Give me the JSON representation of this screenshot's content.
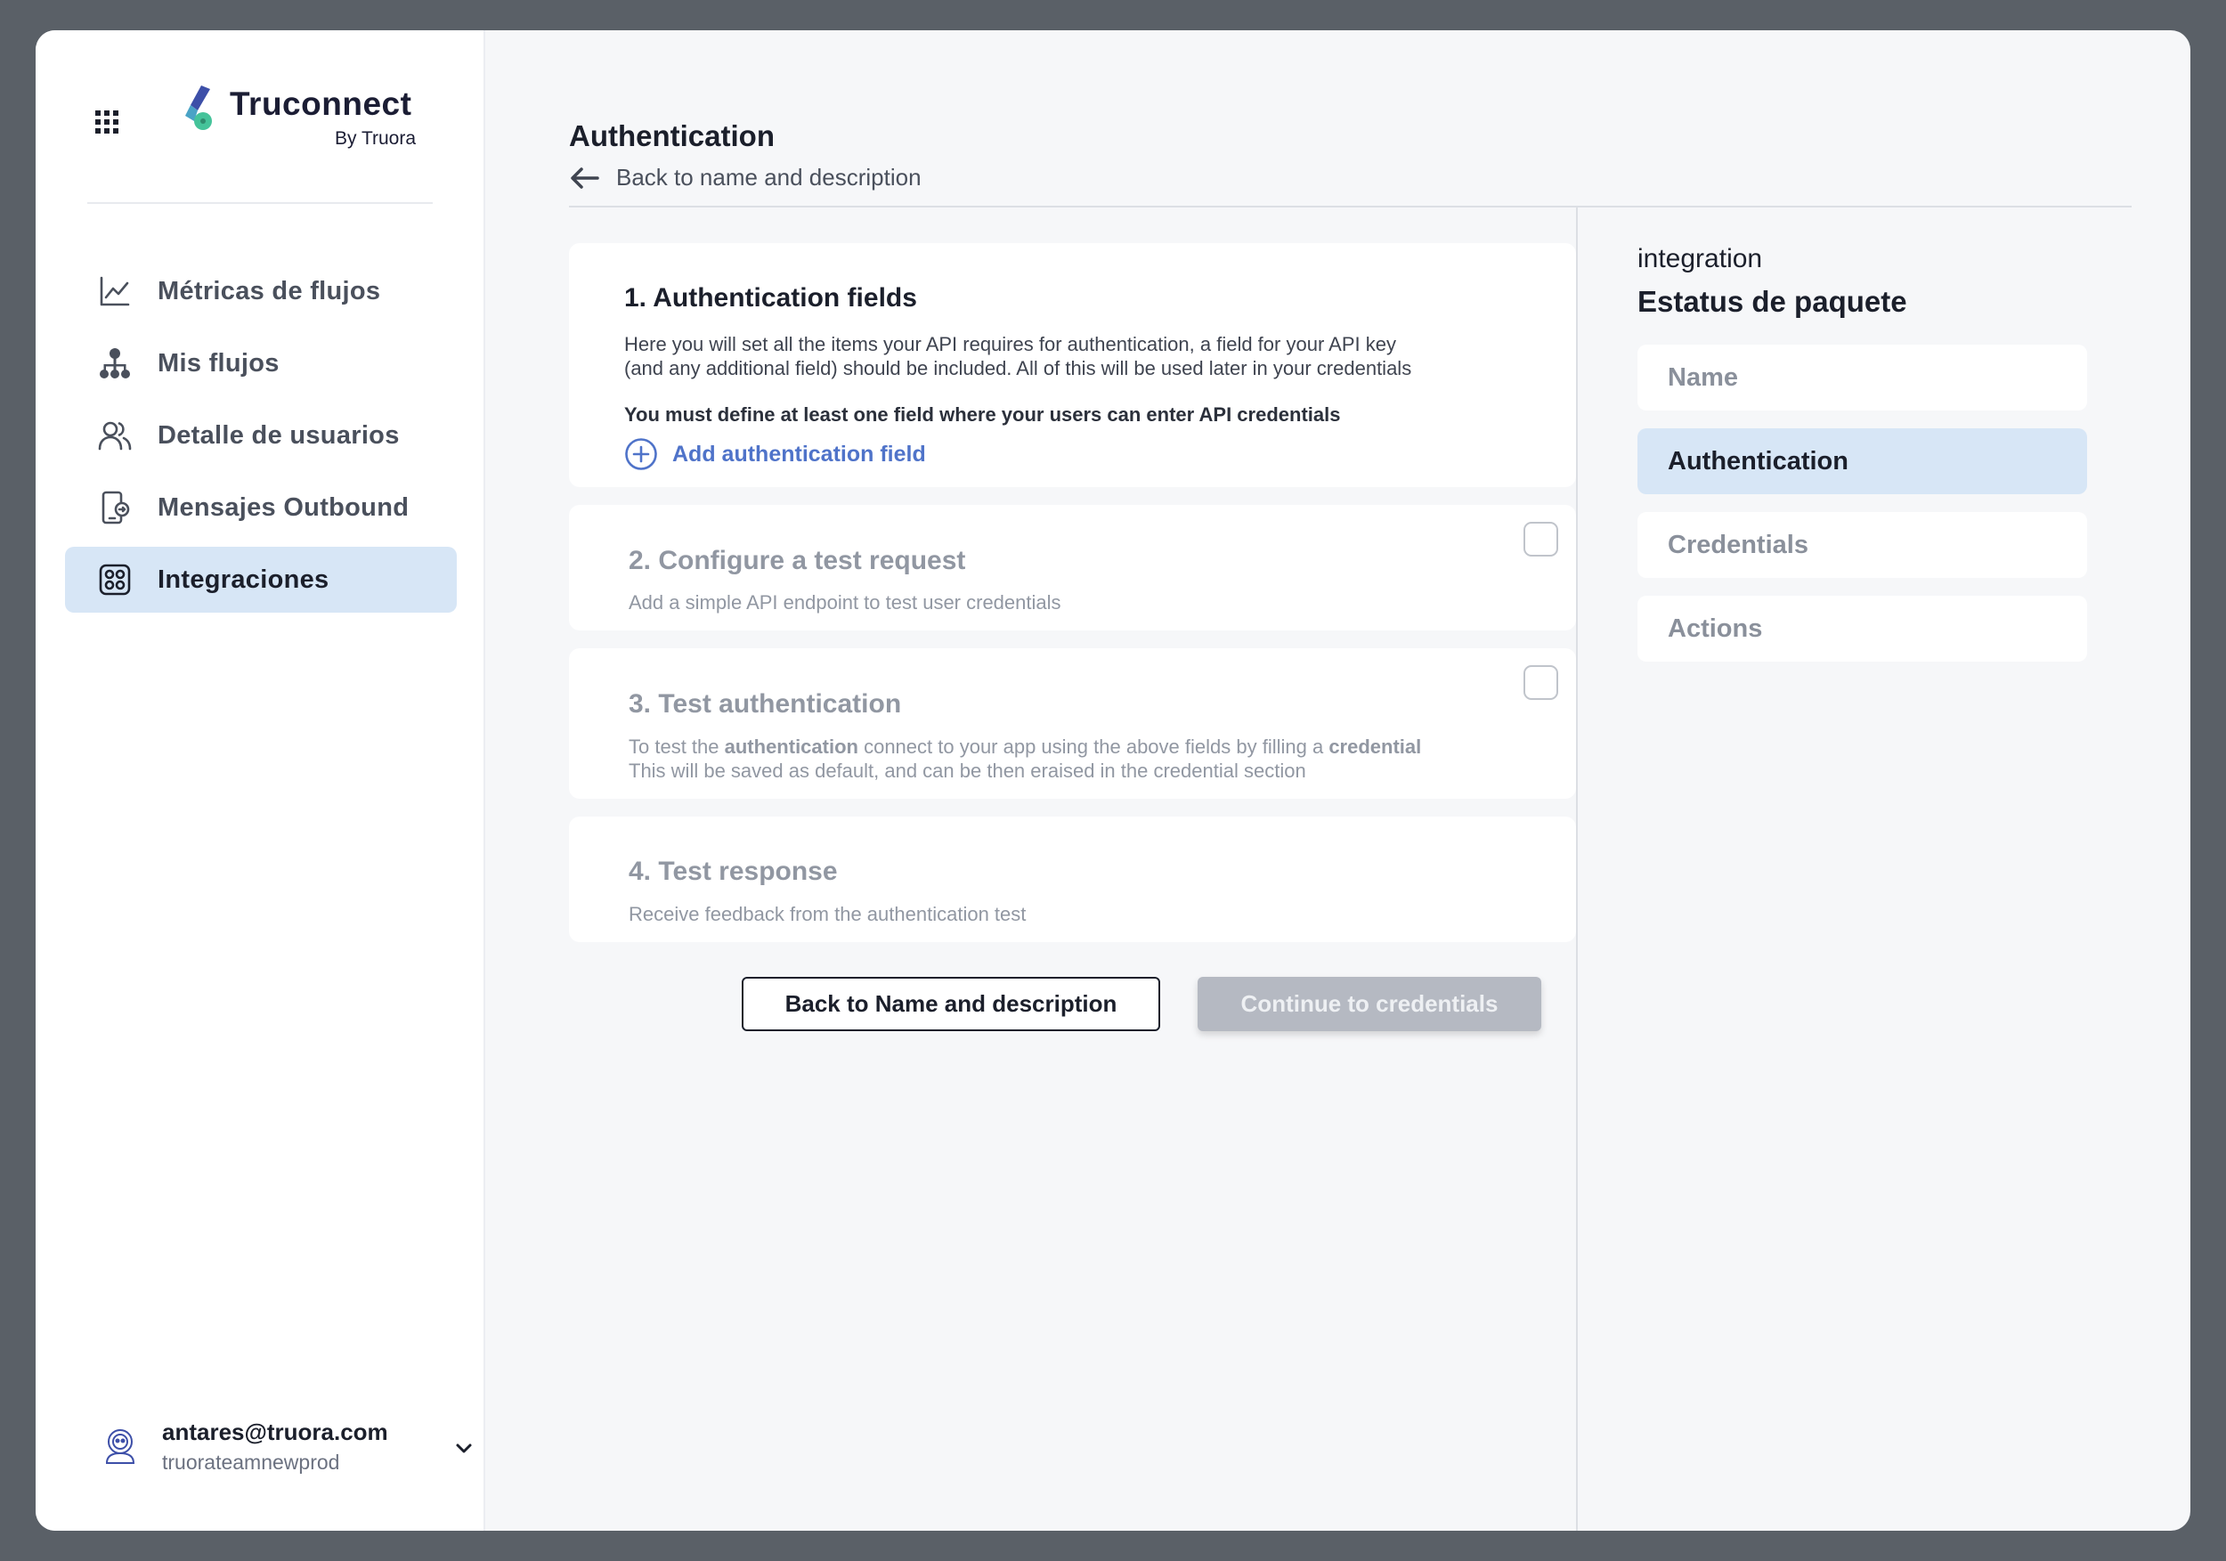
{
  "brand": {
    "name": "Truconnect",
    "sub": "By Truora"
  },
  "sidebar": {
    "items": [
      {
        "label": "Métricas de flujos",
        "icon": "chart-line-icon",
        "active": false
      },
      {
        "label": "Mis flujos",
        "icon": "flow-tree-icon",
        "active": false
      },
      {
        "label": "Detalle de usuarios",
        "icon": "users-icon",
        "active": false
      },
      {
        "label": "Mensajes Outbound",
        "icon": "outbound-message-icon",
        "active": false
      },
      {
        "label": "Integraciones",
        "icon": "integrations-icon",
        "active": true
      }
    ]
  },
  "user": {
    "email": "antares@truora.com",
    "org": "truorateamnewprod"
  },
  "main": {
    "title": "Authentication",
    "back_link": "Back to name and description",
    "cards": [
      {
        "title": "1. Authentication fields",
        "text1": "Here you will set all the items your API requires for authentication, a field for your API key",
        "text2": "(and any additional field) should be included. All of this will be used later in your credentials",
        "warning": "You must define at least one field where your users can enter API credentials",
        "add_label": "Add authentication field"
      },
      {
        "title": "2. Configure a test request",
        "text1": "Add a simple API endpoint to test user credentials"
      },
      {
        "title": "3. Test authentication",
        "text1_a": "To test the ",
        "text1_b": "authentication",
        "text1_c": " connect to your app using the above fields by filling a ",
        "text1_d": "credential",
        "text2": "This will be saved as default, and can be then eraised in the credential section"
      },
      {
        "title": "4. Test response",
        "text1": "Receive feedback from the authentication test"
      }
    ],
    "buttons": {
      "back": "Back to Name and description",
      "continue": "Continue to credentials"
    }
  },
  "panel": {
    "kicker": "integration",
    "title": "Estatus de paquete",
    "steps": [
      {
        "label": "Name",
        "active": false
      },
      {
        "label": "Authentication",
        "active": true
      },
      {
        "label": "Credentials",
        "active": false
      },
      {
        "label": "Actions",
        "active": false
      }
    ]
  },
  "colors": {
    "accent": "#4f73c9",
    "active_bg": "#d7e6f6",
    "frame": "#5a6067"
  }
}
